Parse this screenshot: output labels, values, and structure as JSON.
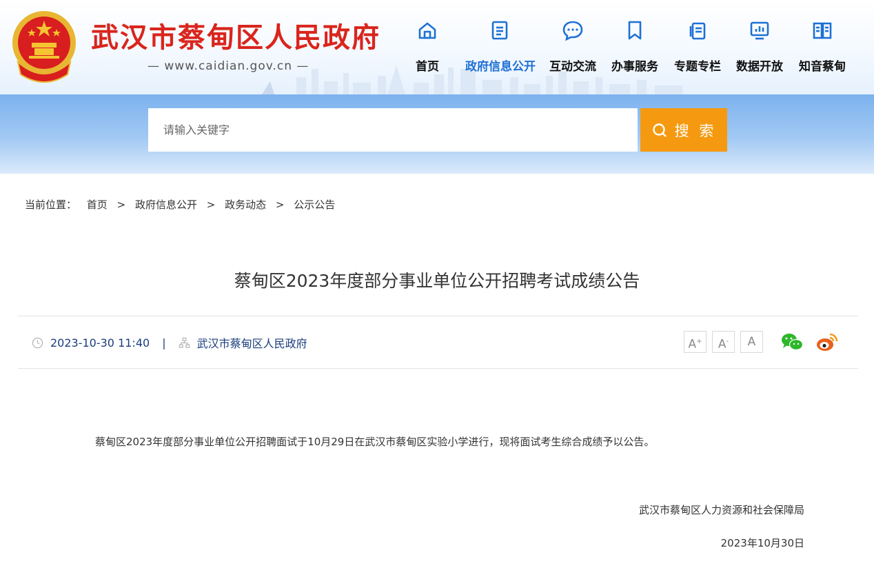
{
  "header": {
    "title": "武汉市蔡甸区人民政府",
    "url": "— www.caidian.gov.cn —",
    "nav": [
      {
        "label": "首页",
        "icon": "home-icon",
        "active": false
      },
      {
        "label": "政府信息公开",
        "icon": "document-list-icon",
        "active": true
      },
      {
        "label": "互动交流",
        "icon": "chat-bubble-icon",
        "active": false
      },
      {
        "label": "办事服务",
        "icon": "bookmark-icon",
        "active": false
      },
      {
        "label": "专题专栏",
        "icon": "stacked-pages-icon",
        "active": false
      },
      {
        "label": "数据开放",
        "icon": "monitor-chart-icon",
        "active": false
      },
      {
        "label": "知音蔡甸",
        "icon": "open-book-icon",
        "active": false
      }
    ]
  },
  "search": {
    "placeholder": "请输入关键字",
    "button_label": "搜 索"
  },
  "breadcrumb": {
    "prefix": "当前位置：",
    "items": [
      "首页",
      "政府信息公开",
      "政务动态",
      "公示公告"
    ],
    "separator": ">"
  },
  "article": {
    "title": "蔡甸区2023年度部分事业单位公开招聘考试成绩公告",
    "datetime": "2023-10-30 11:40",
    "separator": "|",
    "source": "武汉市蔡甸区人民政府",
    "font_controls": {
      "increase": "A",
      "decrease": "A",
      "reset": "A"
    },
    "body": "蔡甸区2023年度部分事业单位公开招聘面试于10月29日在武汉市蔡甸区实验小学进行，现将面试考生综合成绩予以公告。",
    "signature_org": "武汉市蔡甸区人力资源和社会保障局",
    "signature_date": "2023年10月30日"
  },
  "colors": {
    "brand_red": "#d9251d",
    "nav_active": "#1e70d4",
    "search_button": "#f59a10",
    "wechat_green": "#2eb72a",
    "weibo_orange": "#e8621d"
  }
}
